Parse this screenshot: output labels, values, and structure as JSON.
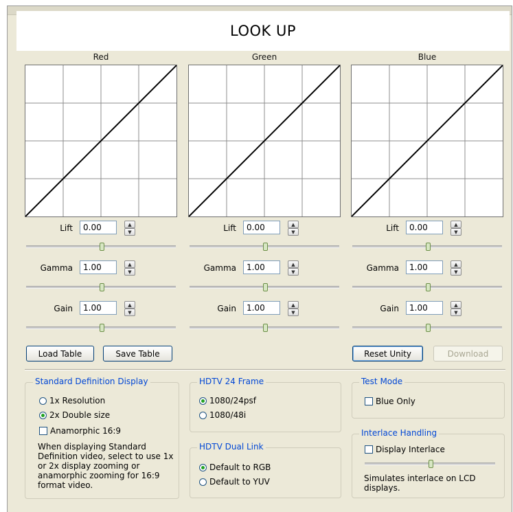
{
  "window": {
    "title": "LOOK UP"
  },
  "channels": [
    {
      "name": "Red",
      "lift": "0.00",
      "gamma": "1.00",
      "gain": "1.00",
      "lift_level": 0.5,
      "gamma_level": 0.5,
      "gain_level": 0.5
    },
    {
      "name": "Green",
      "lift": "0.00",
      "gamma": "1.00",
      "gain": "1.00",
      "lift_level": 0.5,
      "gamma_level": 0.5,
      "gain_level": 0.5
    },
    {
      "name": "Blue",
      "lift": "0.00",
      "gamma": "1.00",
      "gain": "1.00",
      "lift_level": 0.5,
      "gamma_level": 0.5,
      "gain_level": 0.5
    }
  ],
  "labels": {
    "lift": "Lift",
    "gamma": "Gamma",
    "gain": "Gain"
  },
  "buttons": {
    "load_table": "Load Table",
    "save_table": "Save Table",
    "reset_unity": "Reset Unity",
    "download": "Download"
  },
  "sd_display": {
    "legend": "Standard Definition Display",
    "option_1x": "1x Resolution",
    "option_2x": "2x Double size",
    "selected": "2x Double size",
    "anamorphic": "Anamorphic 16:9",
    "anamorphic_checked": false,
    "description": "When displaying Standard Definition video, select to use 1x or 2x display zooming or anamorphic zooming for 16:9 format video."
  },
  "hdtv_24": {
    "legend": "HDTV 24 Frame",
    "option_a": "1080/24psf",
    "option_b": "1080/48i",
    "selected": "1080/24psf"
  },
  "hdtv_dual": {
    "legend": "HDTV Dual Link",
    "option_a": "Default to RGB",
    "option_b": "Default to YUV",
    "selected": "Default to RGB"
  },
  "test_mode": {
    "legend": "Test Mode",
    "blue_only": "Blue Only",
    "blue_only_checked": false
  },
  "interlace": {
    "legend": "Interlace Handling",
    "display_interlace": "Display Interlace",
    "display_interlace_checked": false,
    "slider_level": 0.5,
    "description": "Simulates interlace on LCD displays."
  },
  "colors": {
    "accent": "#0046d5",
    "face": "#ece9d8",
    "radio_dot": "#21a121"
  }
}
